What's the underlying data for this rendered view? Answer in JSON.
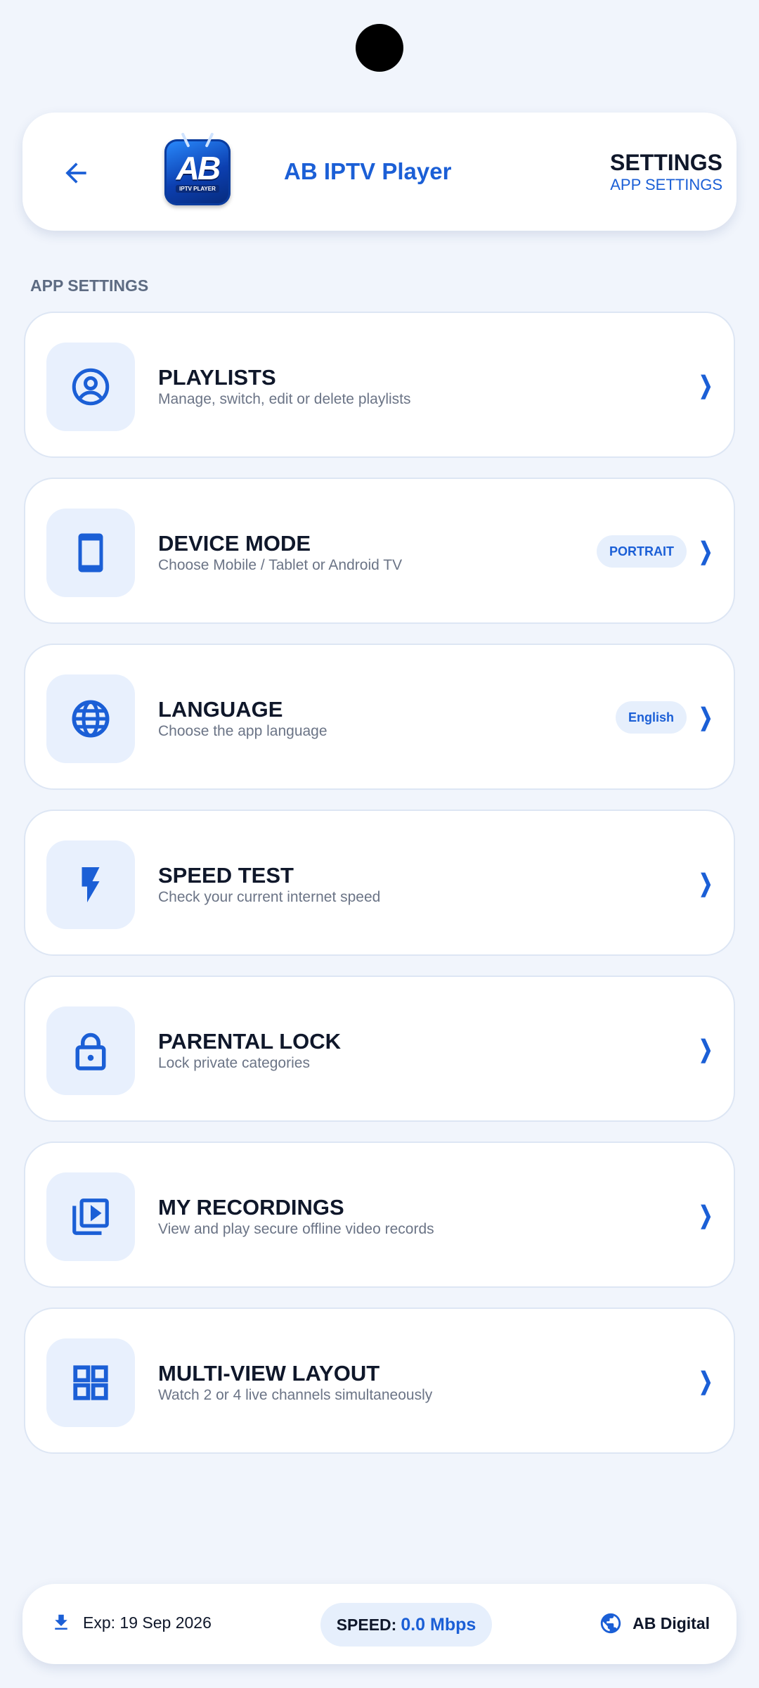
{
  "header": {
    "app_name": "AB IPTV Player",
    "logo_text": "AB",
    "logo_subtext": "IPTV PLAYER",
    "page_title": "SETTINGS",
    "page_subtitle": "APP SETTINGS"
  },
  "section_label": "APP SETTINGS",
  "items": [
    {
      "title": "PLAYLISTS",
      "description": "Manage, switch, edit or delete playlists",
      "icon": "account-circle-icon"
    },
    {
      "title": "DEVICE MODE",
      "description": "Choose Mobile / Tablet or Android TV",
      "badge": "PORTRAIT",
      "icon": "smartphone-icon"
    },
    {
      "title": "LANGUAGE",
      "description": "Choose the app language",
      "badge": "English",
      "icon": "globe-icon"
    },
    {
      "title": "SPEED TEST",
      "description": "Check your current internet speed",
      "icon": "lightning-bolt-icon"
    },
    {
      "title": "PARENTAL LOCK",
      "description": "Lock private categories",
      "icon": "lock-icon"
    },
    {
      "title": "MY RECORDINGS",
      "description": "View and play secure offline video records",
      "icon": "video-library-icon"
    },
    {
      "title": "MULTI-VIEW LAYOUT",
      "description": "Watch 2 or 4 live channels simultaneously",
      "icon": "grid-view-icon"
    }
  ],
  "chevron": "❯",
  "footer": {
    "expiry": "Exp: 19 Sep 2026",
    "speed_label": "SPEED:",
    "speed_value": "0.0 Mbps",
    "brand": "AB Digital"
  },
  "colors": {
    "accent": "#1b5fd6",
    "background": "#f1f5fc",
    "icon_tile": "#e8f0fd",
    "text_primary": "#0f172a",
    "text_secondary": "#6b7486"
  }
}
